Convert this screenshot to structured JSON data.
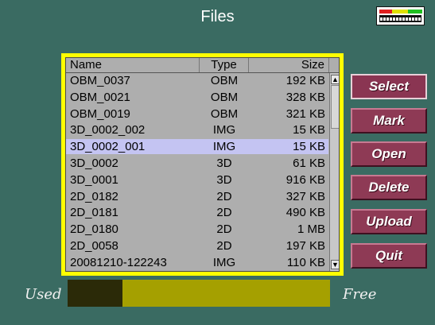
{
  "title": "Files",
  "battery_icon": "battery-level-icon",
  "columns": {
    "name": "Name",
    "type": "Type",
    "size": "Size"
  },
  "files": [
    {
      "name": "OBM_0037",
      "type": "OBM",
      "size": "192 KB"
    },
    {
      "name": "OBM_0021",
      "type": "OBM",
      "size": "328 KB"
    },
    {
      "name": "OBM_0019",
      "type": "OBM",
      "size": "321 KB"
    },
    {
      "name": "3D_0002_002",
      "type": "IMG",
      "size": "15 KB"
    },
    {
      "name": "3D_0002_001",
      "type": "IMG",
      "size": "15 KB",
      "selected": true
    },
    {
      "name": "3D_0002",
      "type": "3D",
      "size": "61 KB"
    },
    {
      "name": "3D_0001",
      "type": "3D",
      "size": "916 KB"
    },
    {
      "name": "2D_0182",
      "type": "2D",
      "size": "327 KB"
    },
    {
      "name": "2D_0181",
      "type": "2D",
      "size": "490 KB"
    },
    {
      "name": "2D_0180",
      "type": "2D",
      "size": "1 MB"
    },
    {
      "name": "2D_0058",
      "type": "2D",
      "size": "197 KB"
    },
    {
      "name": "20081210-122243",
      "type": "IMG",
      "size": "110 KB"
    }
  ],
  "scroll": {
    "up_glyph": "▲",
    "down_glyph": "▼"
  },
  "buttons": {
    "select": "Select",
    "mark": "Mark",
    "open": "Open",
    "delete": "Delete",
    "upload": "Upload",
    "quit": "Quit"
  },
  "storage": {
    "used_label": "Used",
    "free_label": "Free",
    "used_fraction": 0.21
  },
  "colors": {
    "background": "#3a6b62",
    "panel_border": "#ffff00",
    "selected_row": "#c4c4f2",
    "button": "#8e3a55",
    "usage_used": "#2b2a08",
    "usage_free": "#a5a000"
  }
}
